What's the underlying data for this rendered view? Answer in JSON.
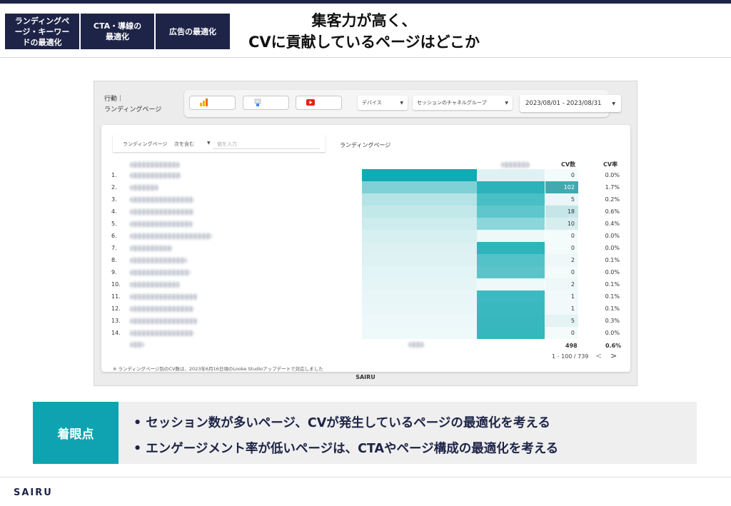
{
  "nav_tabs": [
    "ランディングペ\nージ・キーワー\nドの最適化",
    "CTA・導線の\n最適化",
    "広告の最適化"
  ],
  "headline": [
    "集客力が高く、",
    "CVに貢献しているページはどこか"
  ],
  "report": {
    "title_line1": "行動｜",
    "title_line2": "ランディングページ",
    "device_dropdown": "デバイス",
    "channel_dropdown": "セッションのチャネルグループ",
    "date_range": "2023/08/01 - 2023/08/31",
    "filter_label": "ランディングページ",
    "filter_op": "次を含む",
    "filter_placeholder": "値を入力",
    "table_title": "ランディングページ",
    "col_cv": "CV数",
    "col_cvr": "CV率",
    "rows": [
      {
        "rank": "1.",
        "cv": "0",
        "cvr": "0.0%"
      },
      {
        "rank": "2.",
        "cv": "102",
        "cvr": "1.7%"
      },
      {
        "rank": "3.",
        "cv": "5",
        "cvr": "0.2%"
      },
      {
        "rank": "4.",
        "cv": "18",
        "cvr": "0.6%"
      },
      {
        "rank": "5.",
        "cv": "10",
        "cvr": "0.4%"
      },
      {
        "rank": "6.",
        "cv": "0",
        "cvr": "0.0%"
      },
      {
        "rank": "7.",
        "cv": "0",
        "cvr": "0.0%"
      },
      {
        "rank": "8.",
        "cv": "2",
        "cvr": "0.1%"
      },
      {
        "rank": "9.",
        "cv": "0",
        "cvr": "0.0%"
      },
      {
        "rank": "10.",
        "cv": "2",
        "cvr": "0.1%"
      },
      {
        "rank": "11.",
        "cv": "1",
        "cvr": "0.1%"
      },
      {
        "rank": "12.",
        "cv": "1",
        "cvr": "0.1%"
      },
      {
        "rank": "13.",
        "cv": "5",
        "cvr": "0.3%"
      },
      {
        "rank": "14.",
        "cv": "0",
        "cvr": "0.0%"
      }
    ],
    "total_cv": "498",
    "total_cvr": "0.6%",
    "pagination": "1 - 100 / 739",
    "prev_icon": "<",
    "next_icon": ">",
    "note": "※ ランディングページ別のCV数は、2023年6月16日頃のLooke Studioアップデートで対応しました",
    "brand": "SAIRU"
  },
  "focus": {
    "label": "着眼点",
    "points": [
      "• セッション数が多いページ、CVが発生しているページの最適化を考える",
      "• エンゲージメント率が低いページは、CTAやページ構成の最適化を考える"
    ]
  },
  "footer_logo": "SAIRU",
  "colors": {
    "navy": "#1e2447",
    "teal": "#0fa3b1"
  }
}
